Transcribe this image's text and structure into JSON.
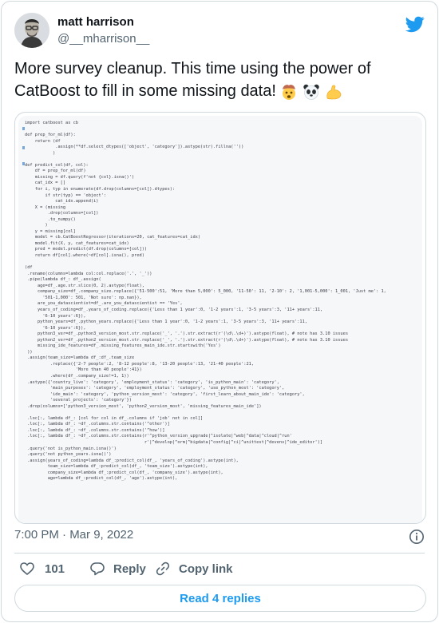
{
  "author": {
    "display_name": "matt harrison",
    "handle": "@__mharrison__"
  },
  "tweet": {
    "text": "More survey cleanup. This time using the power of CatBoost to fill in some missing data!",
    "emojis": [
      "exploding-head-emoji",
      "panda-emoji",
      "flexed-biceps-emoji"
    ]
  },
  "code_lines": [
    "import catboost as cb",
    "",
    "def prep_for_ml(df):",
    "    return (df",
    "            .assign(**df.select_dtypes(['object', 'category']).astype(str).fillna(''))",
    "           )",
    "",
    "def predict_col(df, col):",
    "    df = prep_for_ml(df)",
    "    missing = df.query(f'not {col}.isna()')",
    "    cat_idx = []",
    "    for i, typ in enumerate(df.drop(columns=[col]).dtypes):",
    "        if str(typ) == 'object':",
    "            cat_idx.append(i)",
    "    X = (missing",
    "         .drop(columns=[col])",
    "         .to_numpy()",
    "        )",
    "    y = missing[col]",
    "    model = cb.CatBoostRegressor(iterations=20, cat_features=cat_idx)",
    "    model.fit(X, y, cat_features=cat_idx)",
    "    pred = model.predict(df.drop(columns=[col]))",
    "    return df[col].where(~df[col].isna(), pred)",
    "",
    "(df",
    " .rename(columns=lambda col:col.replace('.', '_'))",
    " .pipe(lambda df_: df_.assign(",
    "     age=df_.age.str.slice(0, 2).astype(float),",
    "     company_size=df_.company_size.replace({'51-500':51, 'More than 5,000': 5_000, '11-50': 11, '2-10': 2, '1,001-5,000': 1_001, 'Just me': 1,",
    "       '501-1,000': 501, 'Not sure': np.nan}),",
    "     are_you_datascientist=df_.are_you_datascientist == 'Yes',",
    "     years_of_coding=df_.years_of_coding.replace({'Less than 1 year':0, '1-2 years':1, '3-5 years':3, '11+ years':11,",
    "       '6-10 years':6}),",
    "     python_years=df_.python_years.replace({'Less than 1 year':0, '1-2 years':1, '3-5 years':3, '11+ years':11,",
    "       '6-10 years':6}),",
    "     python3_ver=df_.python3_version_most.str.replace('_', '.').str.extract(r'(\\d\\.\\d+)').astype(float), # note has 3.10 issues",
    "     python2_ver=df_.python2_version_most.str.replace('_', '.').str.extract(r'(\\d\\.\\d+)').astype(float), # note has 3.10 issues",
    "     missing_ide_features=df_.missing_features_main_ide.str.startswith('Yes')",
    " ))",
    " .assign(team_size=lambda df_:df_.team_size",
    "          .replace({'2-7 people':2, '8-12 people':8, '13-20 people':13, '21-40 people':21,",
    "                    'More than 40 people':41})",
    "          .where(df_.company_size!=1, 1))",
    " .astype({'country_live': 'category', 'employment_status': 'category', 'is_python_main': 'category',",
    "          'main_purposes': 'category', 'employment_status': 'category', 'use_python_most': 'category',",
    "          'ide_main': 'category', 'python_version_most': 'category', 'first_learn_about_main_ide': 'category',",
    "          'several_projects': 'category'})",
    " .drop(columns=['python3_version_most', 'python2_version_most', 'missing_features_main_ide'])",
    "",
    " .loc[:, lambda df_: [col for col in df_.columns if 'job' not in col]]",
    " .loc[:, lambda df_: ~df_.columns.str.contains('^other')]",
    " .loc[:, lambda df_: ~df_.columns.str.contains('^how')]",
    " .loc[:, lambda df_: ~df_.columns.str.contains(r'^python_version_upgrade|^isolate|^web|^data|^cloud|^run'",
    "                                               r'|^develop|^orm|^bigdata|^config|^ci|^unittest|^devenv|^ide_editor')]",
    " .query('not is_python_main.isna()')",
    " .query('not python_years.isna()')",
    " .assign(years_of_coding=lambda df_:predict_col(df_, 'years_of_coding').astype(int),",
    "         team_size=lambda df_:predict_col(df_, 'team_size').astype(int),",
    "         company_size=lambda df_:predict_col(df_, 'company_size').astype(int),",
    "         age=lambda df_:predict_col(df_, 'age').astype(int),"
  ],
  "meta": {
    "timestamp": "7:00 PM · Mar 9, 2022"
  },
  "actions": {
    "likes": "101",
    "reply_label": "Reply",
    "copy_link_label": "Copy link"
  },
  "replies_button": "Read 4 replies",
  "colors": {
    "twitter_blue": "#1d9bf0",
    "like_red": "#f91880",
    "muted_text": "#536471",
    "border": "#cfd9de"
  }
}
